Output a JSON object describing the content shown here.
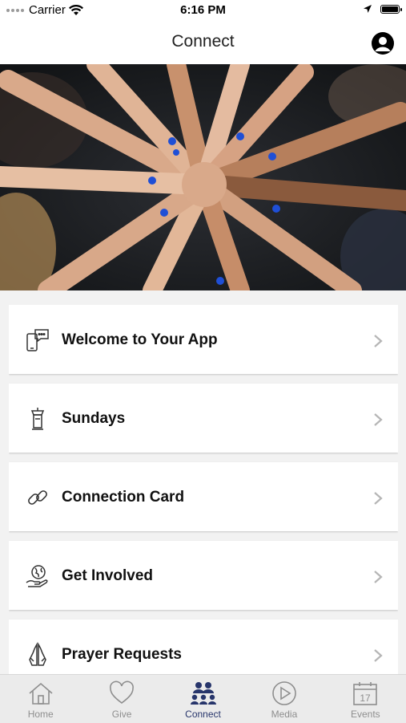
{
  "status_bar": {
    "carrier": "Carrier",
    "time": "6:16 PM"
  },
  "header": {
    "title": "Connect"
  },
  "menu": {
    "items": [
      {
        "label": "Welcome to Your App",
        "icon": "chat-phone-icon"
      },
      {
        "label": "Sundays",
        "icon": "pulpit-icon"
      },
      {
        "label": "Connection Card",
        "icon": "link-icon"
      },
      {
        "label": "Get Involved",
        "icon": "globe-hand-icon"
      },
      {
        "label": "Prayer Requests",
        "icon": "praying-hands-icon"
      }
    ]
  },
  "tabbar": {
    "active_color": "#27356b",
    "tabs": [
      {
        "label": "Home",
        "icon": "home-icon"
      },
      {
        "label": "Give",
        "icon": "heart-icon"
      },
      {
        "label": "Connect",
        "icon": "people-icon"
      },
      {
        "label": "Media",
        "icon": "play-icon"
      },
      {
        "label": "Events",
        "icon": "calendar-icon"
      }
    ],
    "calendar_day": "17"
  }
}
